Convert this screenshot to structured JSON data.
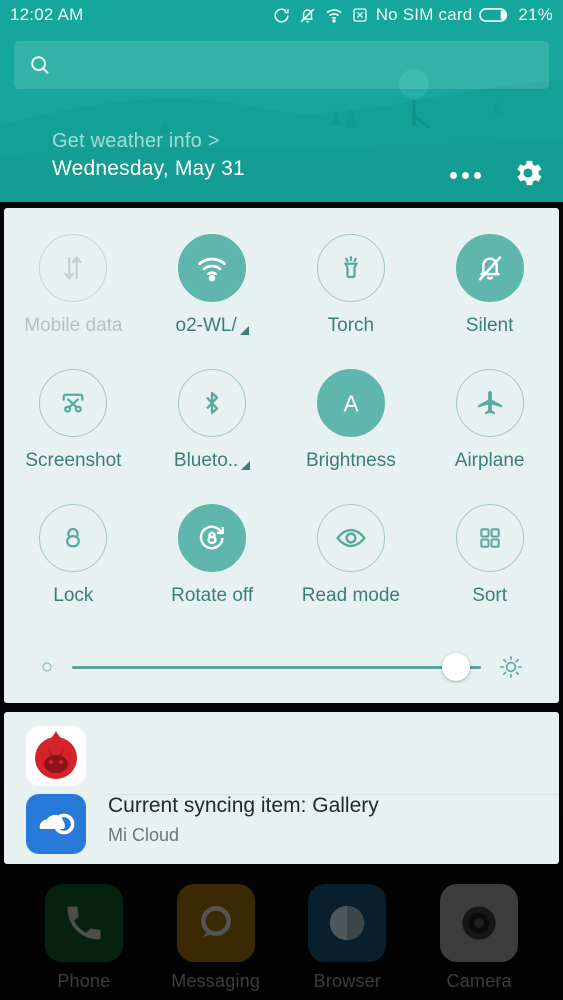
{
  "colors": {
    "header_teal": "#16a79c",
    "panel_bg": "#e8f1f1",
    "active_toggle": "#5eb6ad",
    "toggle_outline": "#9fc9c6",
    "label_teal": "#3c7d7a",
    "disabled_gray": "#b2c3c4"
  },
  "status_bar": {
    "time": "12:02 AM",
    "sim_text": "No SIM card",
    "battery_percent": "21%",
    "icons": [
      "sync-icon",
      "silent-bell-icon",
      "wifi-icon",
      "no-sim-icon",
      "battery-icon"
    ]
  },
  "search": {
    "icon": "search-icon",
    "value": "",
    "placeholder": ""
  },
  "header": {
    "weather_link": "Get weather info >",
    "date": "Wednesday, May 31",
    "more_icon": "more-dots-icon",
    "settings_icon": "gear-icon"
  },
  "toggles": [
    [
      {
        "label": "Mobile data",
        "icon": "mobile-data-icon",
        "state": "disabled",
        "has_arrow": false
      },
      {
        "label": "o2-WL/",
        "icon": "wifi-icon",
        "state": "on",
        "has_arrow": true
      },
      {
        "label": "Torch",
        "icon": "torch-icon",
        "state": "off",
        "has_arrow": false
      },
      {
        "label": "Silent",
        "icon": "silent-bell-icon",
        "state": "on",
        "has_arrow": false
      }
    ],
    [
      {
        "label": "Screenshot",
        "icon": "screenshot-icon",
        "state": "off",
        "has_arrow": false
      },
      {
        "label": "Blueto..",
        "icon": "bluetooth-icon",
        "state": "off",
        "has_arrow": true
      },
      {
        "label": "Brightness",
        "icon": "auto-brightness-icon",
        "state": "on",
        "has_arrow": false
      },
      {
        "label": "Airplane",
        "icon": "airplane-icon",
        "state": "off",
        "has_arrow": false
      }
    ],
    [
      {
        "label": "Lock",
        "icon": "lock-icon",
        "state": "off",
        "has_arrow": false
      },
      {
        "label": "Rotate off",
        "icon": "rotate-lock-icon",
        "state": "on",
        "has_arrow": false
      },
      {
        "label": "Read mode",
        "icon": "eye-icon",
        "state": "off",
        "has_arrow": false
      },
      {
        "label": "Sort",
        "icon": "grid-sort-icon",
        "state": "off",
        "has_arrow": false
      }
    ]
  ],
  "brightness_slider": {
    "value_percent": 94,
    "min_icon": "small-sun-icon",
    "max_icon": "large-sun-icon"
  },
  "notifications": [
    {
      "app_icon": "antutu-icon",
      "title": "",
      "subtitle": ""
    },
    {
      "app_icon": "mi-cloud-icon",
      "title": "Current syncing item: Gallery",
      "subtitle": "Mi Cloud"
    }
  ],
  "dock": [
    {
      "label": "Phone",
      "icon": "phone-icon"
    },
    {
      "label": "Messaging",
      "icon": "message-icon"
    },
    {
      "label": "Browser",
      "icon": "browser-icon"
    },
    {
      "label": "Camera",
      "icon": "camera-icon"
    }
  ]
}
